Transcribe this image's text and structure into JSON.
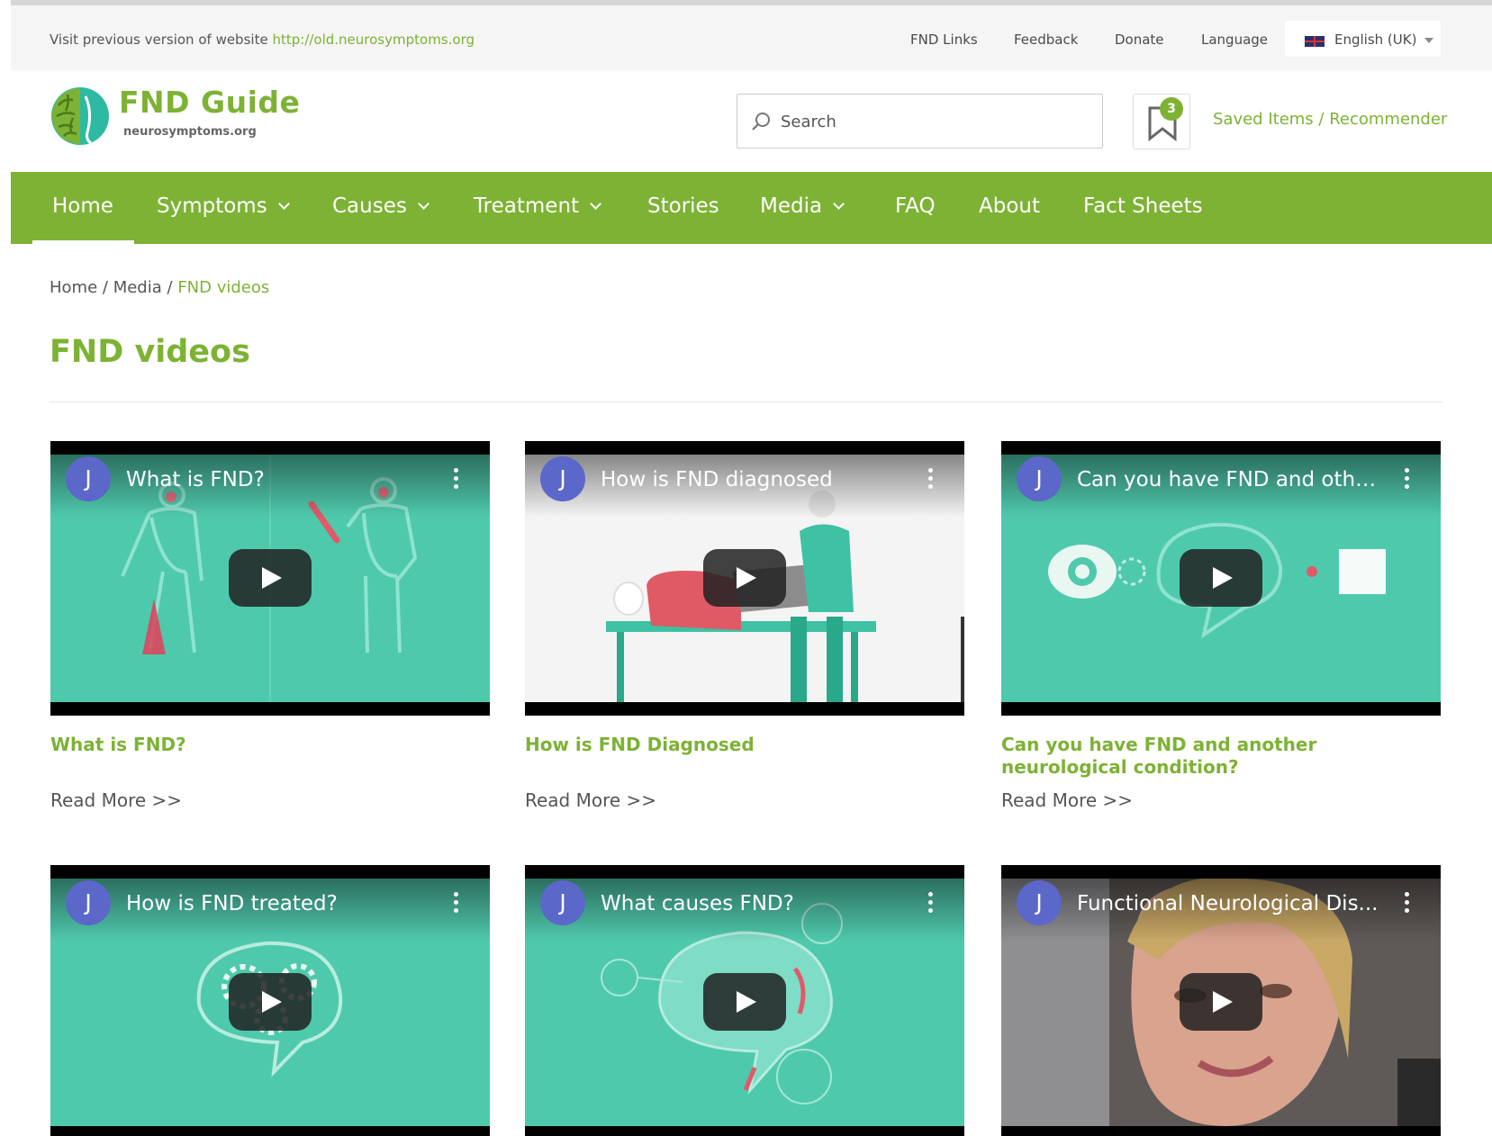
{
  "topbar": {
    "visit_text": "Visit previous version of website",
    "visit_link": "http://old.neurosymptoms.org",
    "links": [
      "FND Links",
      "Feedback",
      "Donate",
      "Language"
    ],
    "language": "English (UK)"
  },
  "header": {
    "logo_title": "FND Guide",
    "logo_sub": "neurosymptoms.org",
    "search_placeholder": "Search",
    "saved_count": "3",
    "saved_label": "Saved Items / Recommender"
  },
  "nav": {
    "items": [
      "Home",
      "Symptoms",
      "Causes",
      "Treatment",
      "Stories",
      "Media",
      "FAQ",
      "About",
      "Fact Sheets"
    ]
  },
  "breadcrumb": {
    "home": "Home",
    "media": "Media",
    "current": "FND videos",
    "sep": "/"
  },
  "page": {
    "title": "FND videos"
  },
  "videos": [
    {
      "channel": "J",
      "video_title": "What is FND?",
      "title": "What is FND?",
      "more": "Read More >>"
    },
    {
      "channel": "J",
      "video_title": "How is FND diagnosed",
      "title": "How is FND Diagnosed",
      "more": "Read More >>"
    },
    {
      "channel": "J",
      "video_title": "Can you have FND and othe...",
      "title": "Can you have FND and another neurological condition?",
      "more": "Read More >>"
    },
    {
      "channel": "J",
      "video_title": "How is FND treated?",
      "title": "",
      "more": ""
    },
    {
      "channel": "J",
      "video_title": "What causes FND?",
      "title": "",
      "more": ""
    },
    {
      "channel": "J",
      "video_title": "Functional Neurological Dis...",
      "title": "",
      "more": ""
    }
  ],
  "colors": {
    "brand_green": "#7db234",
    "teal": "#4fc9ac",
    "channel": "#5b67c9"
  }
}
